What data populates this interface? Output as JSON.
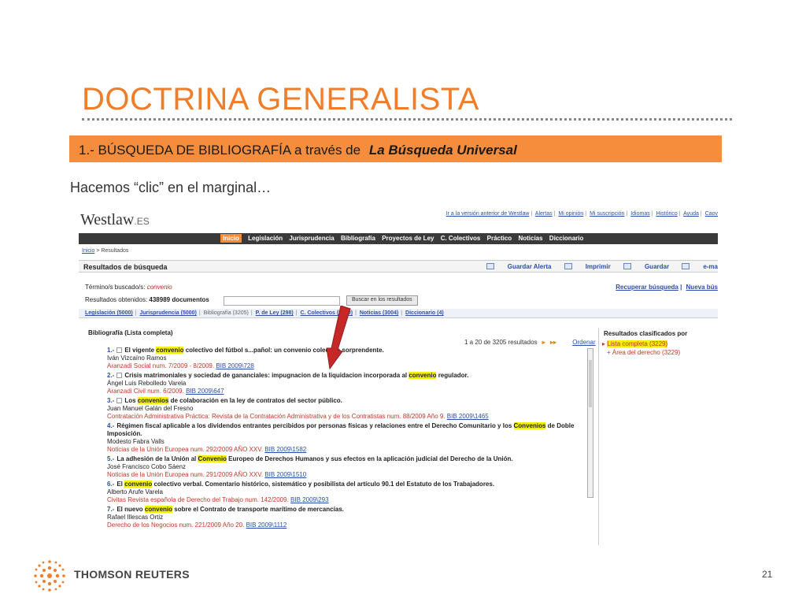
{
  "slide": {
    "title": "DOCTRINA GENERALISTA",
    "banner_prefix": "1.- BÚSQUEDA DE BIBLIOGRAFÍA a través de",
    "banner_emphasis": "La Búsqueda Universal",
    "subtitle": "Hacemos “clic” en el marginal…",
    "company": "THOMSON REUTERS",
    "page_number": "21"
  },
  "app": {
    "logo": "Westlaw",
    "logo_suffix": ".ES",
    "top_links": [
      "Ir a la versión anterior de Westlaw",
      "Alertas",
      "Mi opinión",
      "Mi suscripción",
      "Idiomas",
      "Histórico",
      "Ayuda",
      "Caov"
    ],
    "nav": [
      "Inicio",
      "Legislación",
      "Jurisprudencia",
      "Bibliografía",
      "Proyectos de Ley",
      "C. Colectivos",
      "Práctico",
      "Noticias",
      "Diccionario"
    ],
    "breadcrumb_link": "Inicio",
    "breadcrumb_rest": "> Resultados",
    "results_title": "Resultados de búsqueda",
    "actions": [
      "Guardar Alerta",
      "Imprimir",
      "Guardar",
      "e-ma"
    ],
    "terms_label": "Término/s buscado/s:",
    "terms_value": "convenio",
    "obtained_label": "Resultados obtenidos:",
    "obtained_value": "438989 documentos",
    "search_button": "Buscar en los resultados",
    "recover_links": [
      "Recuperar búsqueda",
      "Nueva bús"
    ],
    "tabs": [
      "Legislación (5000)",
      "Jurisprudencia (5000)",
      "Bibliografía (3205)",
      "P. de Ley (298)",
      "C. Colectivos (5000)",
      "Noticias (3004)",
      "Diccionario (4)"
    ],
    "list_title": "Bibliografía (Lista completa)",
    "pager": "1 a 20 de 3205 resultados",
    "sort_link": "Ordenar",
    "side_title": "Resultados clasificados por",
    "side_item1": "Lista completa (3229)",
    "side_item2": "Área del derecho (3229)"
  },
  "results": [
    {
      "num": "1.-",
      "pre": "El vigente ",
      "kw": "convenio",
      "post": " colectivo del fútbol s...pañol: un convenio colectivo sorprendente.",
      "author": "Iván Vizcaíno Ramos",
      "src": "Aranzadi Social num. 7/2009 - 8/2009.",
      "ref": "BIB 2009\\728"
    },
    {
      "num": "2.-",
      "pre": "Crisis matrimoniales y sociedad de gananciales: impugnacion de la liquidacion incorporada al ",
      "kw": "convenio",
      "post": " regulador.",
      "author": "Ángel Luis Rebolledo Varela",
      "src": "Aranzadi Civil num. 6/2009.",
      "ref": "BIB 2009\\647"
    },
    {
      "num": "3.-",
      "pre": "Los ",
      "kw": "convenios",
      "post": " de colaboración en la ley de contratos del sector público.",
      "author": "Juan Manuel Galán del Fresno",
      "src": "Contratación Administrativa Práctica: Revista de la Contratación Administrativa y de los Contratistas num. 88/2009 Año 9.",
      "ref": "BIB 2009\\1465"
    },
    {
      "num": "4.-",
      "pre": "Régimen fiscal aplicable a los dividendos entrantes percibidos por personas físicas y relaciones entre el Derecho Comunitario y los ",
      "kw": "Convenios",
      "post": " de Doble Imposición.",
      "author": "Modesto Fabra Valls",
      "src": "Noticias de la Unión Europea num. 292/2009 AÑO XXV.",
      "ref": "BIB 2009\\1582"
    },
    {
      "num": "5.-",
      "pre": "La adhesión de la Unión al ",
      "kw": "Convenio",
      "post": " Europeo de Derechos Humanos y sus efectos en la aplicación judicial del Derecho de la Unión.",
      "author": "José Francisco Cobo Sáenz",
      "src": "Noticias de la Unión Europea num. 291/2009 AÑO XXV.",
      "ref": "BIB 2009\\1510"
    },
    {
      "num": "6.-",
      "pre": "El ",
      "kw": "convenio",
      "post": " colectivo verbal. Comentario histórico, sistemático y posibilista del artículo 90.1 del Estatuto de los Trabajadores.",
      "author": "Alberto Arufe Varela",
      "src": "Civitas Revista española de Derecho del Trabajo num. 142/2009.",
      "ref": "BIB 2009\\293"
    },
    {
      "num": "7.-",
      "pre": "El nuevo ",
      "kw": "convenio",
      "post": " sobre el Contrato de transporte marítimo de mercancías.",
      "author": "Rafael Illescas Ortiz",
      "src": "Derecho de los Negocios num. 221/2009 Año 20.",
      "ref": "BIB 2009\\1112"
    }
  ]
}
